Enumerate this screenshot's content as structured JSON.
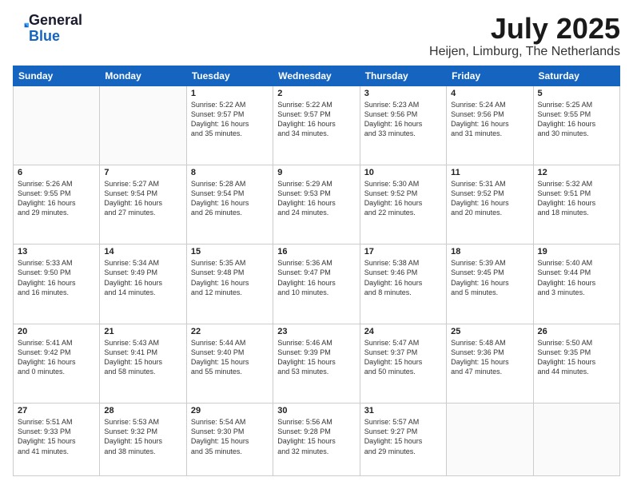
{
  "header": {
    "logo_line1": "General",
    "logo_line2": "Blue",
    "month_title": "July 2025",
    "location": "Heijen, Limburg, The Netherlands"
  },
  "days_of_week": [
    "Sunday",
    "Monday",
    "Tuesday",
    "Wednesday",
    "Thursday",
    "Friday",
    "Saturday"
  ],
  "weeks": [
    [
      {
        "day": "",
        "content": ""
      },
      {
        "day": "",
        "content": ""
      },
      {
        "day": "1",
        "content": "Sunrise: 5:22 AM\nSunset: 9:57 PM\nDaylight: 16 hours\nand 35 minutes."
      },
      {
        "day": "2",
        "content": "Sunrise: 5:22 AM\nSunset: 9:57 PM\nDaylight: 16 hours\nand 34 minutes."
      },
      {
        "day": "3",
        "content": "Sunrise: 5:23 AM\nSunset: 9:56 PM\nDaylight: 16 hours\nand 33 minutes."
      },
      {
        "day": "4",
        "content": "Sunrise: 5:24 AM\nSunset: 9:56 PM\nDaylight: 16 hours\nand 31 minutes."
      },
      {
        "day": "5",
        "content": "Sunrise: 5:25 AM\nSunset: 9:55 PM\nDaylight: 16 hours\nand 30 minutes."
      }
    ],
    [
      {
        "day": "6",
        "content": "Sunrise: 5:26 AM\nSunset: 9:55 PM\nDaylight: 16 hours\nand 29 minutes."
      },
      {
        "day": "7",
        "content": "Sunrise: 5:27 AM\nSunset: 9:54 PM\nDaylight: 16 hours\nand 27 minutes."
      },
      {
        "day": "8",
        "content": "Sunrise: 5:28 AM\nSunset: 9:54 PM\nDaylight: 16 hours\nand 26 minutes."
      },
      {
        "day": "9",
        "content": "Sunrise: 5:29 AM\nSunset: 9:53 PM\nDaylight: 16 hours\nand 24 minutes."
      },
      {
        "day": "10",
        "content": "Sunrise: 5:30 AM\nSunset: 9:52 PM\nDaylight: 16 hours\nand 22 minutes."
      },
      {
        "day": "11",
        "content": "Sunrise: 5:31 AM\nSunset: 9:52 PM\nDaylight: 16 hours\nand 20 minutes."
      },
      {
        "day": "12",
        "content": "Sunrise: 5:32 AM\nSunset: 9:51 PM\nDaylight: 16 hours\nand 18 minutes."
      }
    ],
    [
      {
        "day": "13",
        "content": "Sunrise: 5:33 AM\nSunset: 9:50 PM\nDaylight: 16 hours\nand 16 minutes."
      },
      {
        "day": "14",
        "content": "Sunrise: 5:34 AM\nSunset: 9:49 PM\nDaylight: 16 hours\nand 14 minutes."
      },
      {
        "day": "15",
        "content": "Sunrise: 5:35 AM\nSunset: 9:48 PM\nDaylight: 16 hours\nand 12 minutes."
      },
      {
        "day": "16",
        "content": "Sunrise: 5:36 AM\nSunset: 9:47 PM\nDaylight: 16 hours\nand 10 minutes."
      },
      {
        "day": "17",
        "content": "Sunrise: 5:38 AM\nSunset: 9:46 PM\nDaylight: 16 hours\nand 8 minutes."
      },
      {
        "day": "18",
        "content": "Sunrise: 5:39 AM\nSunset: 9:45 PM\nDaylight: 16 hours\nand 5 minutes."
      },
      {
        "day": "19",
        "content": "Sunrise: 5:40 AM\nSunset: 9:44 PM\nDaylight: 16 hours\nand 3 minutes."
      }
    ],
    [
      {
        "day": "20",
        "content": "Sunrise: 5:41 AM\nSunset: 9:42 PM\nDaylight: 16 hours\nand 0 minutes."
      },
      {
        "day": "21",
        "content": "Sunrise: 5:43 AM\nSunset: 9:41 PM\nDaylight: 15 hours\nand 58 minutes."
      },
      {
        "day": "22",
        "content": "Sunrise: 5:44 AM\nSunset: 9:40 PM\nDaylight: 15 hours\nand 55 minutes."
      },
      {
        "day": "23",
        "content": "Sunrise: 5:46 AM\nSunset: 9:39 PM\nDaylight: 15 hours\nand 53 minutes."
      },
      {
        "day": "24",
        "content": "Sunrise: 5:47 AM\nSunset: 9:37 PM\nDaylight: 15 hours\nand 50 minutes."
      },
      {
        "day": "25",
        "content": "Sunrise: 5:48 AM\nSunset: 9:36 PM\nDaylight: 15 hours\nand 47 minutes."
      },
      {
        "day": "26",
        "content": "Sunrise: 5:50 AM\nSunset: 9:35 PM\nDaylight: 15 hours\nand 44 minutes."
      }
    ],
    [
      {
        "day": "27",
        "content": "Sunrise: 5:51 AM\nSunset: 9:33 PM\nDaylight: 15 hours\nand 41 minutes."
      },
      {
        "day": "28",
        "content": "Sunrise: 5:53 AM\nSunset: 9:32 PM\nDaylight: 15 hours\nand 38 minutes."
      },
      {
        "day": "29",
        "content": "Sunrise: 5:54 AM\nSunset: 9:30 PM\nDaylight: 15 hours\nand 35 minutes."
      },
      {
        "day": "30",
        "content": "Sunrise: 5:56 AM\nSunset: 9:28 PM\nDaylight: 15 hours\nand 32 minutes."
      },
      {
        "day": "31",
        "content": "Sunrise: 5:57 AM\nSunset: 9:27 PM\nDaylight: 15 hours\nand 29 minutes."
      },
      {
        "day": "",
        "content": ""
      },
      {
        "day": "",
        "content": ""
      }
    ]
  ]
}
